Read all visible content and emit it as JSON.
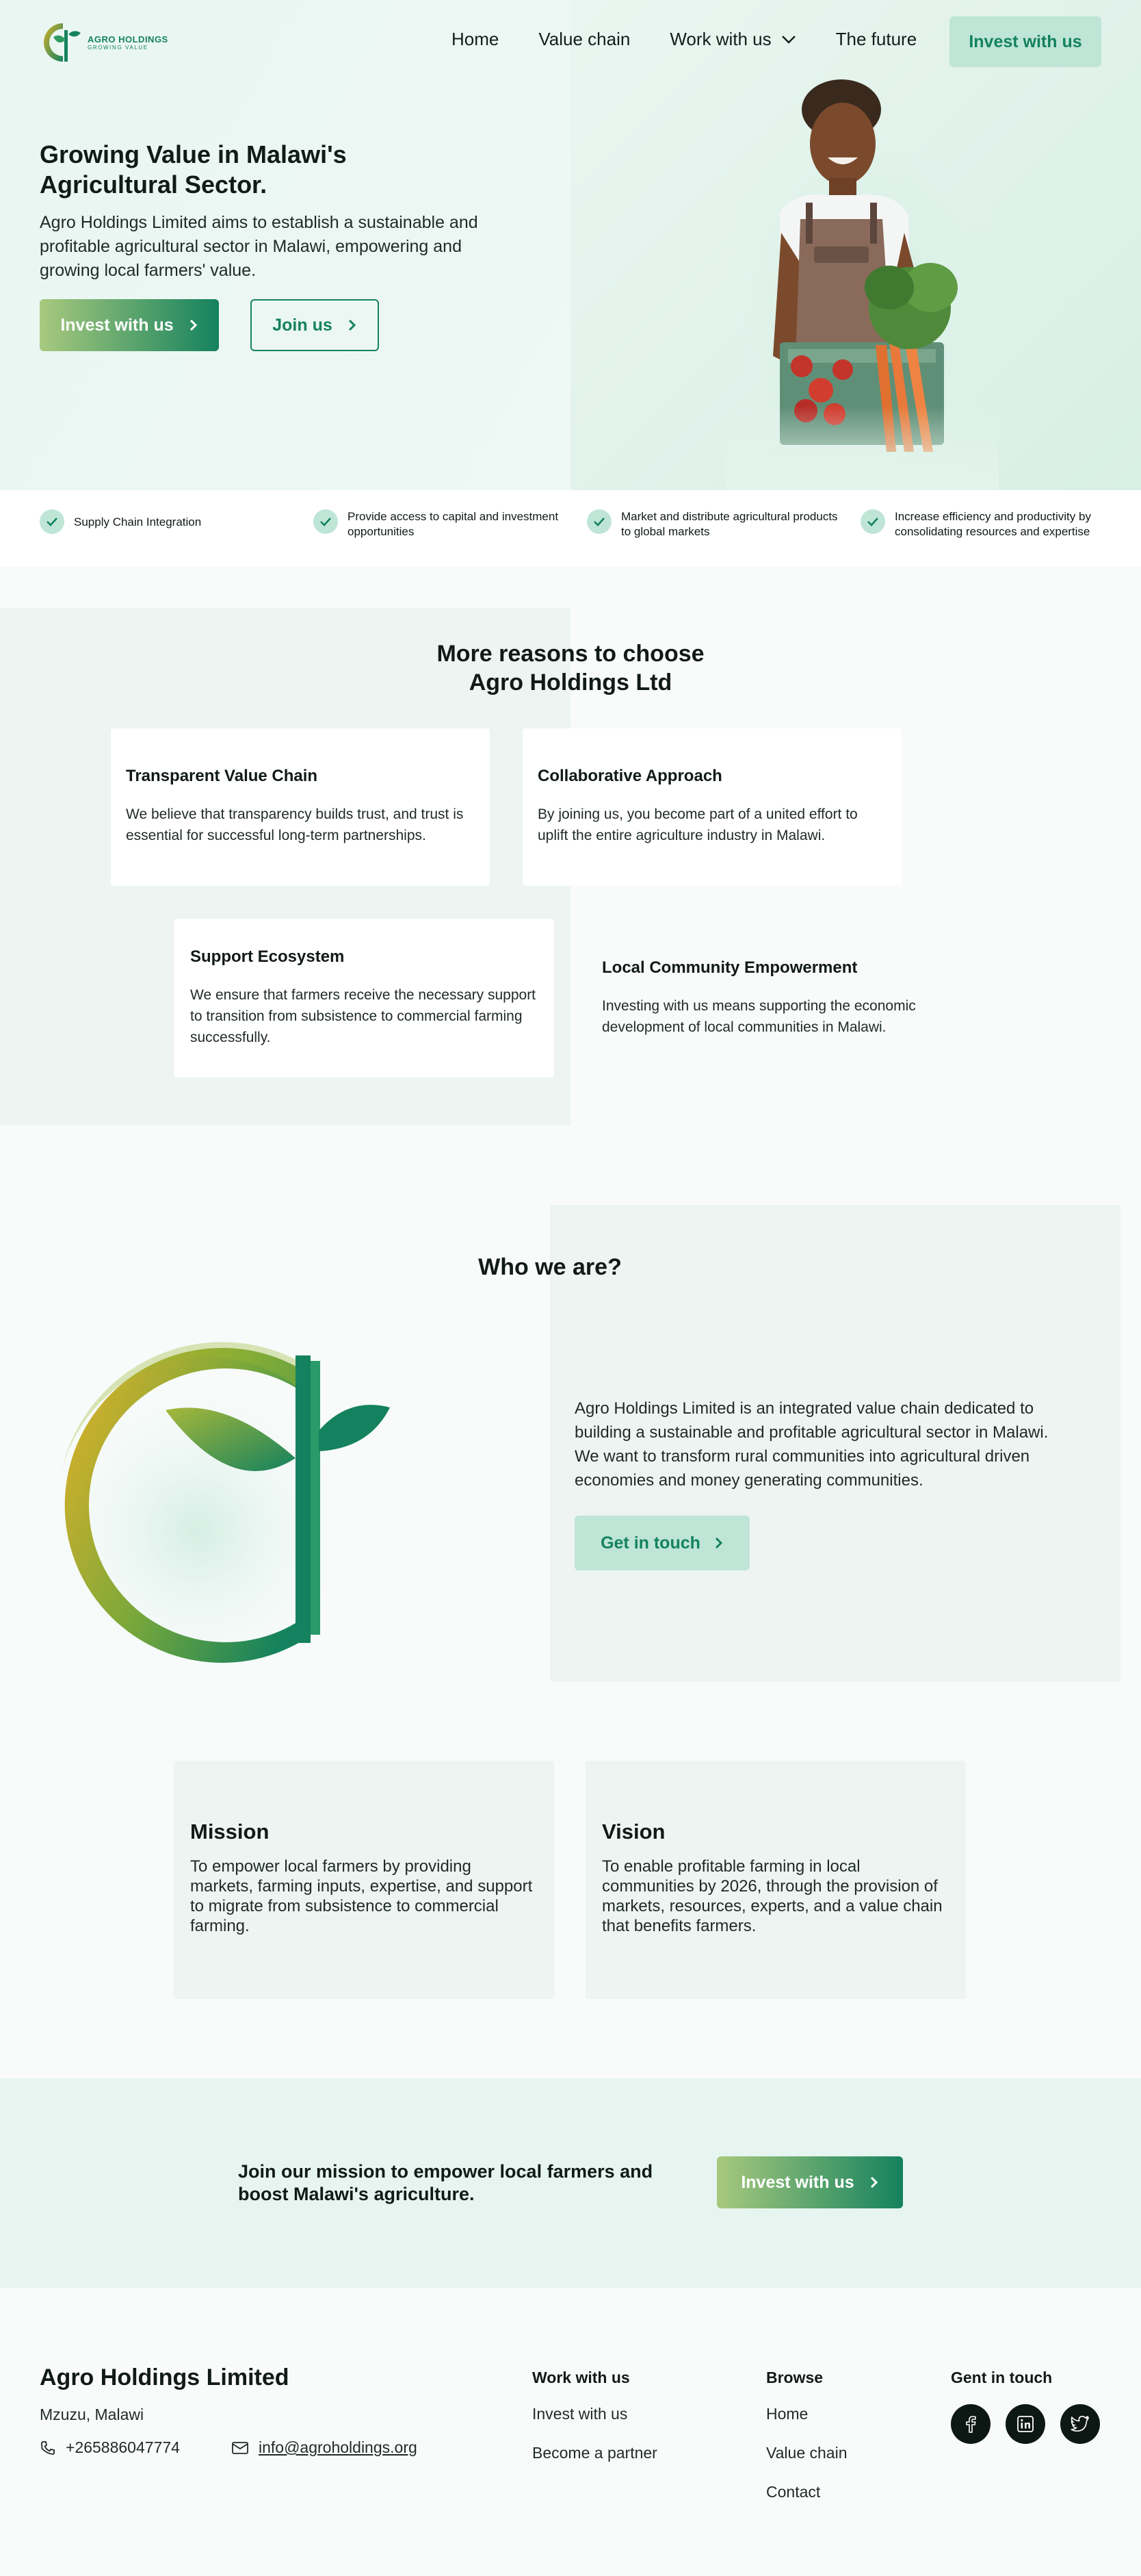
{
  "brand": {
    "logo_line1": "AGRO HOLDINGS",
    "logo_line2": "GROWING VALUE"
  },
  "nav": {
    "items": [
      "Home",
      "Value chain",
      "Work with us",
      "The future"
    ],
    "cta": "Invest with us"
  },
  "hero": {
    "title": "Growing Value in Malawi's Agricultural Sector.",
    "subtitle": "Agro Holdings Limited  aims to establish a sustainable and profitable agricultural sector in Malawi, empowering and growing local farmers' value.",
    "primary_button": "Invest with us",
    "secondary_button": "Join us"
  },
  "features": [
    "Supply Chain Integration",
    "Provide access to capital and investment opportunities",
    "Market and distribute agricultural products to global markets",
    "Increase efficiency and productivity by consolidating resources and expertise"
  ],
  "reasons": {
    "title_line1": "More reasons to choose",
    "title_line2": "Agro Holdings Ltd",
    "cards": [
      {
        "title": "Transparent Value Chain",
        "text": " We believe that transparency builds trust, and trust is essential for successful long-term partnerships."
      },
      {
        "title": "Collaborative Approach",
        "text": "By joining us, you become part of a united effort to uplift the entire agriculture industry in Malawi."
      },
      {
        "title": "Support Ecosystem",
        "text": "We ensure that farmers receive the necessary support to transition from subsistence to commercial farming successfully."
      },
      {
        "title": "Local Community Empowerment",
        "text": "Investing with us  means supporting the economic development of local communities in Malawi."
      }
    ]
  },
  "who": {
    "title": "Who we are?",
    "text": "Agro Holdings Limited  is an integrated value chain dedicated to building a sustainable and profitable agricultural sector in Malawi. We want to transform rural communities into agricultural driven economies and money generating communities.",
    "button": "Get in touch"
  },
  "mission": {
    "title": "Mission",
    "text": "To empower local farmers by providing markets, farming inputs, expertise, and support to migrate from subsistence to commercial farming."
  },
  "vision": {
    "title": "Vision",
    "text": "To enable profitable farming in local communities by 2026, through the provision of markets, resources, experts, and a value chain that benefits farmers."
  },
  "cta": {
    "text": "Join our mission to empower local farmers and boost Malawi's agriculture.",
    "button": "Invest with us"
  },
  "footer": {
    "company": "Agro Holdings Limited",
    "city": "Mzuzu, Malawi",
    "phone": "+265886047774",
    "email": "info@agroholdings.org",
    "work_heading": "Work with us",
    "work_links": [
      "Invest with us",
      "Become a partner"
    ],
    "browse_heading": "Browse",
    "browse_links": [
      "Home",
      "Value chain",
      "Contact"
    ],
    "touch_heading": "Gent in touch",
    "socials": [
      "facebook-icon",
      "linkedin-icon",
      "twitter-icon"
    ]
  },
  "colors": {
    "primary": "#14825e",
    "soft": "#bfe5d7",
    "gradient_start": "#a8c97e",
    "panel": "#edf4f2"
  }
}
